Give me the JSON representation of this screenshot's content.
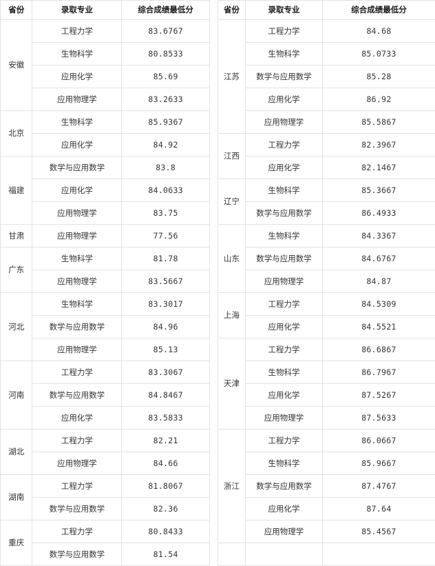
{
  "headers": {
    "province": "省份",
    "major": "录取专业",
    "score": "综合成绩最低分"
  },
  "left_table": {
    "groups": [
      {
        "province": "安徽",
        "rows": [
          {
            "major": "工程力学",
            "score": "83.6767"
          },
          {
            "major": "生物科学",
            "score": "80.8533"
          },
          {
            "major": "应用化学",
            "score": "85.69"
          },
          {
            "major": "应用物理学",
            "score": "83.2633"
          }
        ]
      },
      {
        "province": "北京",
        "rows": [
          {
            "major": "生物科学",
            "score": "85.9367"
          },
          {
            "major": "应用化学",
            "score": "84.92"
          }
        ]
      },
      {
        "province": "福建",
        "rows": [
          {
            "major": "数学与应用数学",
            "score": "83.8"
          },
          {
            "major": "应用化学",
            "score": "84.0633"
          },
          {
            "major": "应用物理学",
            "score": "83.75"
          }
        ]
      },
      {
        "province": "甘肃",
        "rows": [
          {
            "major": "应用物理学",
            "score": "77.56"
          }
        ]
      },
      {
        "province": "广东",
        "rows": [
          {
            "major": "生物科学",
            "score": "81.78"
          },
          {
            "major": "应用物理学",
            "score": "83.5667"
          }
        ]
      },
      {
        "province": "河北",
        "rows": [
          {
            "major": "生物科学",
            "score": "83.3017"
          },
          {
            "major": "数学与应用数学",
            "score": "84.96"
          },
          {
            "major": "应用物理学",
            "score": "85.13"
          }
        ]
      },
      {
        "province": "河南",
        "rows": [
          {
            "major": "工程力学",
            "score": "83.3067"
          },
          {
            "major": "数学与应用数学",
            "score": "84.8467"
          },
          {
            "major": "应用化学",
            "score": "83.5833"
          }
        ]
      },
      {
        "province": "湖北",
        "rows": [
          {
            "major": "工程力学",
            "score": "82.21"
          },
          {
            "major": "应用物理学",
            "score": "84.66"
          }
        ]
      },
      {
        "province": "湖南",
        "rows": [
          {
            "major": "工程力学",
            "score": "81.8067"
          },
          {
            "major": "数学与应用数学",
            "score": "82.36"
          }
        ]
      },
      {
        "province": "重庆",
        "rows": [
          {
            "major": "工程力学",
            "score": "80.8433"
          },
          {
            "major": "数学与应用数学",
            "score": "81.54"
          }
        ]
      }
    ]
  },
  "right_table": {
    "groups": [
      {
        "province": "江苏",
        "rows": [
          {
            "major": "工程力学",
            "score": "84.68"
          },
          {
            "major": "生物科学",
            "score": "85.0733"
          },
          {
            "major": "数学与应用数学",
            "score": "85.28"
          },
          {
            "major": "应用化学",
            "score": "86.92"
          },
          {
            "major": "应用物理学",
            "score": "85.5867"
          }
        ]
      },
      {
        "province": "江西",
        "rows": [
          {
            "major": "工程力学",
            "score": "82.3967"
          },
          {
            "major": "应用化学",
            "score": "82.1467"
          }
        ]
      },
      {
        "province": "辽宁",
        "rows": [
          {
            "major": "生物科学",
            "score": "85.3667"
          },
          {
            "major": "数学与应用数学",
            "score": "86.4933"
          }
        ]
      },
      {
        "province": "山东",
        "rows": [
          {
            "major": "生物科学",
            "score": "84.3367"
          },
          {
            "major": "数学与应用数学",
            "score": "84.6767"
          },
          {
            "major": "应用物理学",
            "score": "84.87"
          }
        ]
      },
      {
        "province": "上海",
        "rows": [
          {
            "major": "工程力学",
            "score": "84.5309"
          },
          {
            "major": "应用化学",
            "score": "84.5521"
          }
        ]
      },
      {
        "province": "天津",
        "rows": [
          {
            "major": "工程力学",
            "score": "86.6867"
          },
          {
            "major": "生物科学",
            "score": "86.7967"
          },
          {
            "major": "应用化学",
            "score": "87.5267"
          },
          {
            "major": "应用物理学",
            "score": "87.5633"
          }
        ]
      },
      {
        "province": "浙江",
        "rows": [
          {
            "major": "工程力学",
            "score": "86.0667"
          },
          {
            "major": "生物科学",
            "score": "85.9667"
          },
          {
            "major": "数学与应用数学",
            "score": "87.4767"
          },
          {
            "major": "应用化学",
            "score": "87.64"
          },
          {
            "major": "应用物理学",
            "score": "85.4567"
          }
        ]
      }
    ],
    "trailing_blank_rows": 1
  }
}
